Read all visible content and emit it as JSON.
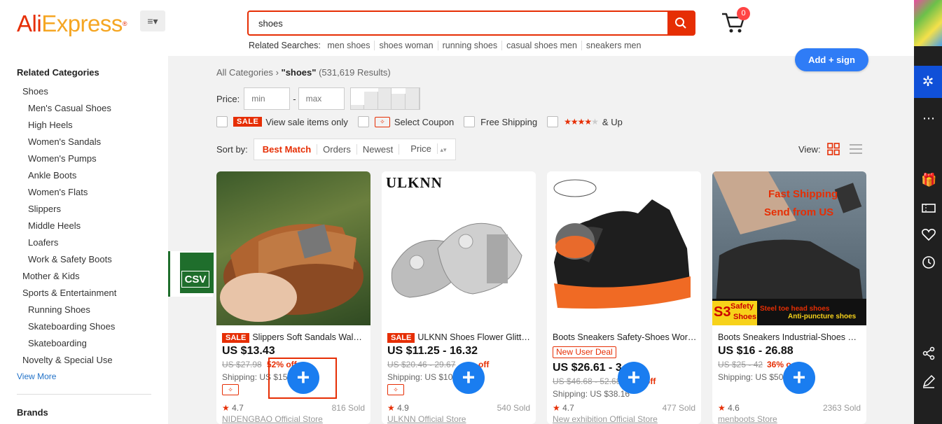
{
  "header": {
    "logo_part1": "Ali",
    "logo_part2": "Express",
    "logo_tm": "®",
    "menu_icon": "≡▾",
    "search_value": "shoes",
    "cart_count": "0",
    "related_label": "Related Searches:",
    "related_searches": [
      "men shoes",
      "shoes woman",
      "running shoes",
      "casual shoes men",
      "sneakers men"
    ]
  },
  "sidebar": {
    "heading": "Related Categories",
    "categories": [
      {
        "label": "Shoes",
        "level": 1
      },
      {
        "label": "Men's Casual Shoes",
        "level": 2
      },
      {
        "label": "High Heels",
        "level": 2
      },
      {
        "label": "Women's Sandals",
        "level": 2
      },
      {
        "label": "Women's Pumps",
        "level": 2
      },
      {
        "label": "Ankle Boots",
        "level": 2
      },
      {
        "label": "Women's Flats",
        "level": 2
      },
      {
        "label": "Slippers",
        "level": 2
      },
      {
        "label": "Middle Heels",
        "level": 2
      },
      {
        "label": "Loafers",
        "level": 2
      },
      {
        "label": "Work & Safety Boots",
        "level": 2
      },
      {
        "label": "Mother & Kids",
        "level": 1
      },
      {
        "label": "Sports & Entertainment",
        "level": 1
      },
      {
        "label": "Running Shoes",
        "level": 2
      },
      {
        "label": "Skateboarding Shoes",
        "level": 2
      },
      {
        "label": "Skateboarding",
        "level": 2
      },
      {
        "label": "Novelty & Special Use",
        "level": 1
      }
    ],
    "view_more": "View More",
    "brands_heading": "Brands"
  },
  "csv_label": "CSV",
  "breadcrumb": {
    "root": "All Categories",
    "sep": "›",
    "query": "\"shoes\"",
    "count": "(531,619 Results)"
  },
  "add_sign": "Add + sign",
  "price_filter": {
    "label": "Price:",
    "min_placeholder": "min",
    "max_placeholder": "max",
    "dash": "-"
  },
  "filters": {
    "sale_badge": "SALE",
    "sale_label": "View sale items only",
    "coupon_label": "Select Coupon",
    "free_shipping_label": "Free Shipping",
    "rating_stars": "★★★★",
    "rating_star_empty": "★",
    "rating_label": "& Up"
  },
  "sort": {
    "label": "Sort by:",
    "options": [
      "Best Match",
      "Orders",
      "Newest",
      "Price"
    ],
    "active": "Best Match",
    "price_arrows": "▴▾"
  },
  "view": {
    "label": "View:"
  },
  "products": [
    {
      "sale_badge": "SALE",
      "title": "Slippers Soft Sandals Walking Comfortable",
      "price": "US $13.43",
      "original": "US $27.98",
      "discount": "52% off",
      "shipping": "Shipping: US $15",
      "rating": "4.7",
      "sold": "816 Sold",
      "store": "NIDENGBAO Official Store"
    },
    {
      "sale_badge": "SALE",
      "brand_overlay": "ULKNN",
      "title": "ULKNN Shoes Flower Glitter Girls",
      "price": "US $11.25 - 16.32",
      "original": "US $20.46 - 29.67",
      "discount": "off",
      "shipping": "Shipping: US $10",
      "rating": "4.9",
      "sold": "540 Sold",
      "store": "ULKNN Official Store"
    },
    {
      "new_user_deal": "New User Deal",
      "title": "Boots Sneakers Safety-Shoes Work Men",
      "price": "US $26.61 - 3",
      "original": "US $46.68 - 52.68",
      "discount": "off",
      "shipping": "Shipping: US $38.16",
      "rating": "4.7",
      "sold": "477 Sold",
      "store": "New exhibition Official Store"
    },
    {
      "title": "Boots Sneakers Industrial-Shoes Safety",
      "price": "US $16 - 26.88",
      "original": "US $25 - 42",
      "discount": "36% o",
      "shipping": "Shipping: US $50",
      "rating": "4.6",
      "sold": "2363 Sold",
      "store": "menboots Store",
      "overlay_top": "Fast Shipping",
      "overlay_mid": "Send from US",
      "overlay_s3": "S3",
      "overlay_safety": "Safety",
      "overlay_shoes": "Shoes",
      "overlay_steel": "Steel toe head shoes",
      "overlay_anti": "Anti-puncture shoes"
    }
  ],
  "plus_symbol": "+",
  "colors": {
    "brand_red": "#e62e04",
    "brand_orange": "#f5a623",
    "accent_blue": "#1a7df0",
    "right_bar": "#202020"
  }
}
